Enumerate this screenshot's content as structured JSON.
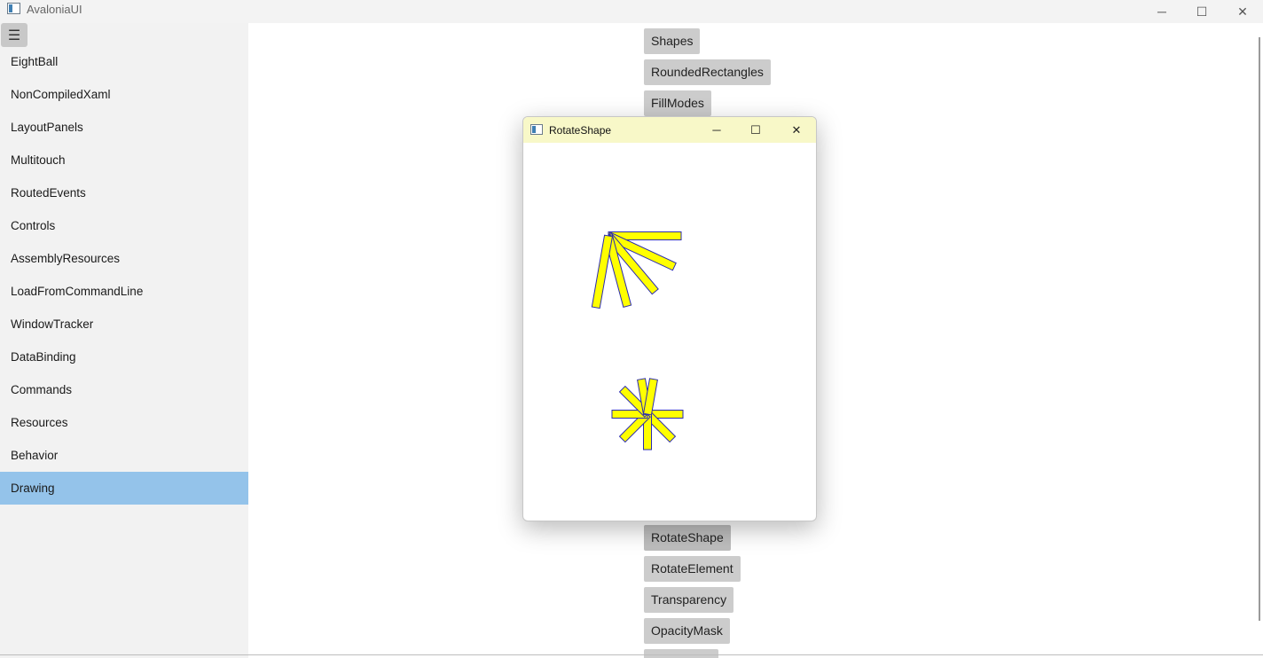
{
  "window": {
    "title": "AvaloniaUI",
    "icon": "app-window-icon",
    "minimize_icon": "─",
    "maximize_icon": "☐",
    "close_icon": "✕"
  },
  "sidebar": {
    "menu_icon": "☰",
    "items": [
      {
        "label": "EightBall"
      },
      {
        "label": "NonCompiledXaml"
      },
      {
        "label": "LayoutPanels"
      },
      {
        "label": "Multitouch"
      },
      {
        "label": "RoutedEvents"
      },
      {
        "label": "Controls"
      },
      {
        "label": "AssemblyResources"
      },
      {
        "label": "LoadFromCommandLine"
      },
      {
        "label": "WindowTracker"
      },
      {
        "label": "DataBinding"
      },
      {
        "label": "Commands"
      },
      {
        "label": "Resources"
      },
      {
        "label": "Behavior"
      },
      {
        "label": "Drawing",
        "selected": true
      }
    ],
    "selected_color": "#94c3ea"
  },
  "content": {
    "buttons": [
      {
        "label": "Shapes"
      },
      {
        "label": "RoundedRectangles"
      },
      {
        "label": "FillModes"
      },
      {
        "label": "RotateShape"
      },
      {
        "label": "RotateElement"
      },
      {
        "label": "Transparency"
      },
      {
        "label": "OpacityMask"
      }
    ]
  },
  "popup": {
    "title": "RotateShape",
    "minimize_icon": "─",
    "maximize_icon": "☐",
    "close_icon": "✕",
    "titlebar_color": "#f8f8c8",
    "shape_fill": "#ffff00",
    "shape_stroke": "#2b2bb0",
    "top_group_angles_deg": [
      0,
      25,
      50,
      75,
      100
    ],
    "bottom_group_angles_deg": [
      0,
      45,
      90,
      135,
      180,
      225,
      260,
      280
    ]
  }
}
